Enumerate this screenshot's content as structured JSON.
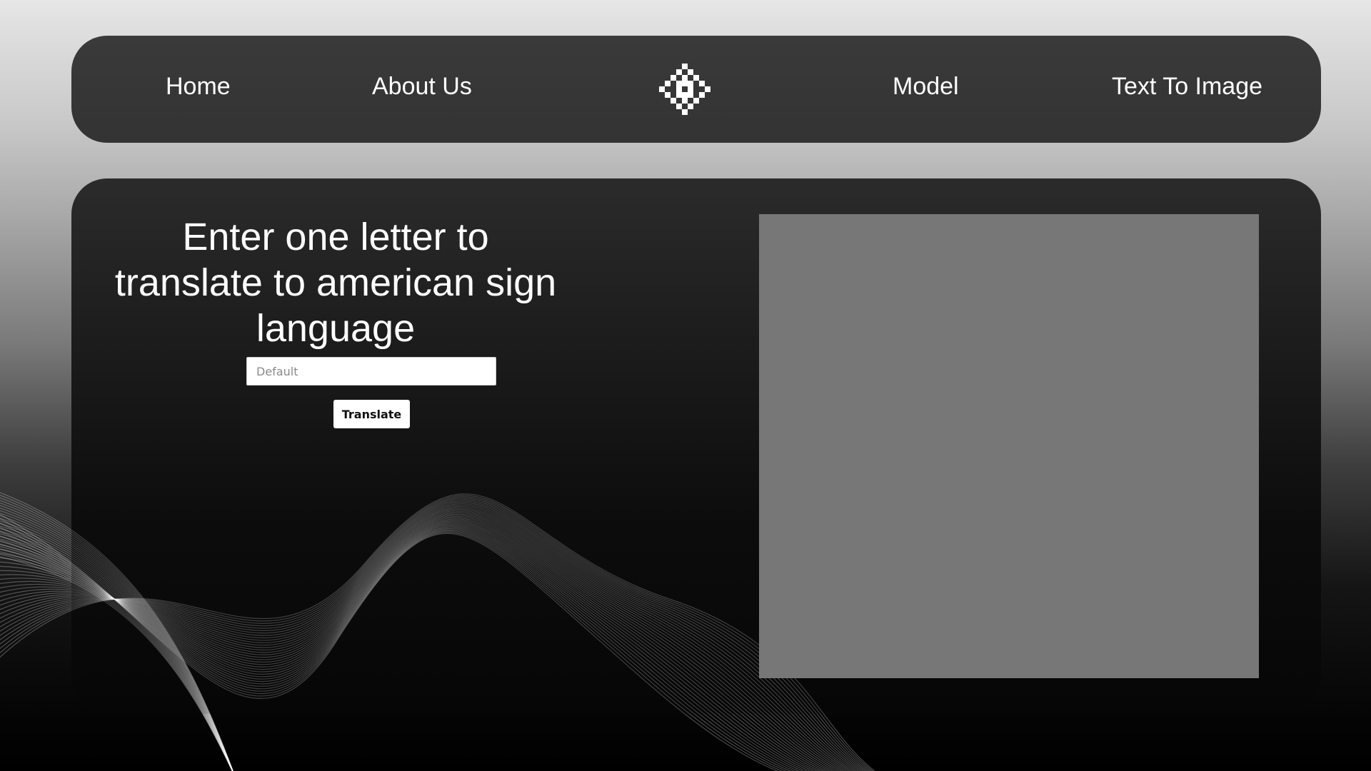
{
  "nav": {
    "home_label": "Home",
    "about_label": "About Us",
    "logo_icon": "pixel-flower-logo-icon",
    "model_label": "Model",
    "text_to_image_label": "Text To Image"
  },
  "main": {
    "heading": "Enter one letter to translate to american sign language",
    "input": {
      "value": "",
      "placeholder": "Default"
    },
    "translate_label": "Translate",
    "output_image": {
      "alt": ""
    }
  },
  "colors": {
    "nav_background": "#353535",
    "panel_background": "#1a1a1a",
    "image_placeholder": "#777777",
    "text": "#ffffff"
  }
}
